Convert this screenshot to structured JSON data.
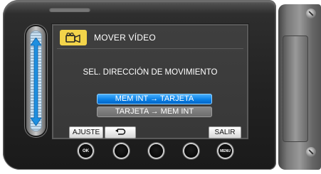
{
  "screen": {
    "header": {
      "icon": "video-camera-icon",
      "title": "MOVER VÍDEO"
    },
    "prompt": "SEL. DIRECCIÓN DE MOVIMIENTO",
    "options": [
      {
        "label": "MEM INT → TARJETA",
        "selected": true
      },
      {
        "label": "TARJETA → MEM INT",
        "selected": false
      }
    ],
    "softkeys": {
      "adjust": "AJUSTE",
      "back_icon": "return-arrow-icon",
      "exit": "SALIR"
    }
  },
  "hardware_buttons": [
    {
      "name": "ok-button",
      "label": "OK"
    },
    {
      "name": "blank-button-1",
      "label": ""
    },
    {
      "name": "blank-button-2",
      "label": ""
    },
    {
      "name": "blank-button-3",
      "label": ""
    },
    {
      "name": "menu-button",
      "label": "MENU"
    }
  ],
  "colors": {
    "highlight": "#0a80e6",
    "header_icon_bg": "#f3d44a",
    "screen_bg": "#3a3a3a"
  }
}
